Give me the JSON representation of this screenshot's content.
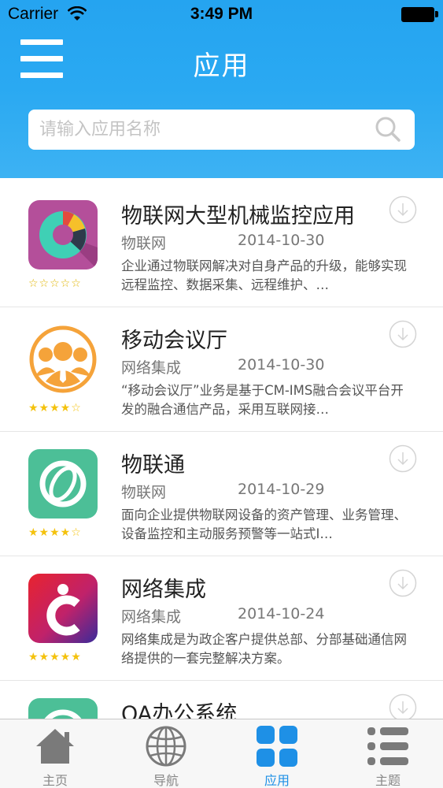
{
  "status_bar": {
    "carrier": "Carrier",
    "time": "3:49 PM"
  },
  "header": {
    "title": "应用"
  },
  "search": {
    "placeholder": "请输入应用名称"
  },
  "apps": [
    {
      "name": "物联网大型机械监控应用",
      "category": "物联网",
      "date": "2014-10-30",
      "description": "企业通过物联网解决对自身产品的升级，能够实现远程监控、数据采集、远程维护、…",
      "rating_stars": "☆☆☆☆☆",
      "rating": 0
    },
    {
      "name": "移动会议厅",
      "category": "网络集成",
      "date": "2014-10-30",
      "description": "“移动会议厅”业务是基于CM-IMS融合会议平台开发的融合通信产品，采用互联网接…",
      "rating_stars": "★★★★☆",
      "rating": 4
    },
    {
      "name": "物联通",
      "category": "物联网",
      "date": "2014-10-29",
      "description": "面向企业提供物联网设备的资产管理、业务管理、设备监控和主动服务预警等一站式I…",
      "rating_stars": "★★★★☆",
      "rating": 4
    },
    {
      "name": "网络集成",
      "category": "网络集成",
      "date": "2014-10-24",
      "description": "网络集成是为政企客户提供总部、分部基础通信网络提供的一套完整解决方案。",
      "rating_stars": "★★★★★",
      "rating": 5
    },
    {
      "name": "OA办公系统",
      "category": "",
      "date": "",
      "description": "",
      "rating_stars": "",
      "rating": null
    }
  ],
  "tabbar": {
    "tabs": [
      {
        "label": "主页",
        "icon": "home-icon"
      },
      {
        "label": "导航",
        "icon": "globe-icon"
      },
      {
        "label": "应用",
        "icon": "grid-icon"
      },
      {
        "label": "主题",
        "icon": "list-icon"
      }
    ],
    "active_index": 2
  },
  "colors": {
    "header_blue": "#25a4f0",
    "active_tab": "#1e90e6",
    "star": "#f4c20d"
  }
}
